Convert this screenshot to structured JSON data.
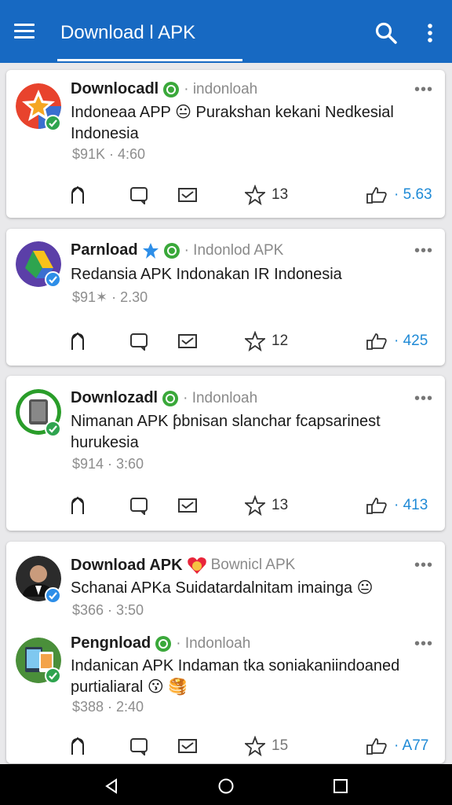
{
  "appbar": {
    "title": "Download l APK",
    "bg_color": "#1769c2",
    "icons": [
      "menu-icon",
      "search-icon",
      "overflow-menu-icon"
    ]
  },
  "posts": [
    {
      "name": "Downlocadl",
      "handle": "· indonloah",
      "text": "Indoneaa APP 😐 Purakshan kekani Nedkesial Indonesia",
      "meta": "$91K · 4:60",
      "star_count": "13",
      "like_count": "· 5.63",
      "avatar_icon": "star-logo-avatar"
    },
    {
      "name": "Parnload",
      "handle": "· Indonlod APK",
      "text": "Redansia APK Indonakan IR Indonesia",
      "meta": "$91✶ · 2.30",
      "star_count": "12",
      "like_count": "· 425",
      "avatar_icon": "drive-logo-avatar"
    },
    {
      "name": "Downlozadl",
      "handle": "· Indonloah",
      "text": "Nimanan APK ƥbnisan slanchar fcapsarinest hurukesia",
      "meta": "$914 · 3:60",
      "star_count": "13",
      "like_count": "· 413",
      "avatar_icon": "phone-avatar"
    },
    {
      "name": "Download APK",
      "handle": "Bownicl APK",
      "text": "Schanai APKa Suidatardalnitam imainga 😐",
      "meta": "$366 · 3:50",
      "avatar_icon": "person-avatar"
    },
    {
      "name": "Pengnload",
      "handle": "· Indonloah",
      "text": "Indanican APK Indaman tka soniakaniindoaned purtialiaral 😗 🥞",
      "meta": "$388 · 2:40",
      "star_count": "15",
      "like_count": "· A77",
      "avatar_icon": "app-screens-avatar"
    }
  ],
  "more_label": "•••",
  "navbar": {
    "icons": [
      "back-icon",
      "home-icon",
      "recents-icon"
    ]
  }
}
